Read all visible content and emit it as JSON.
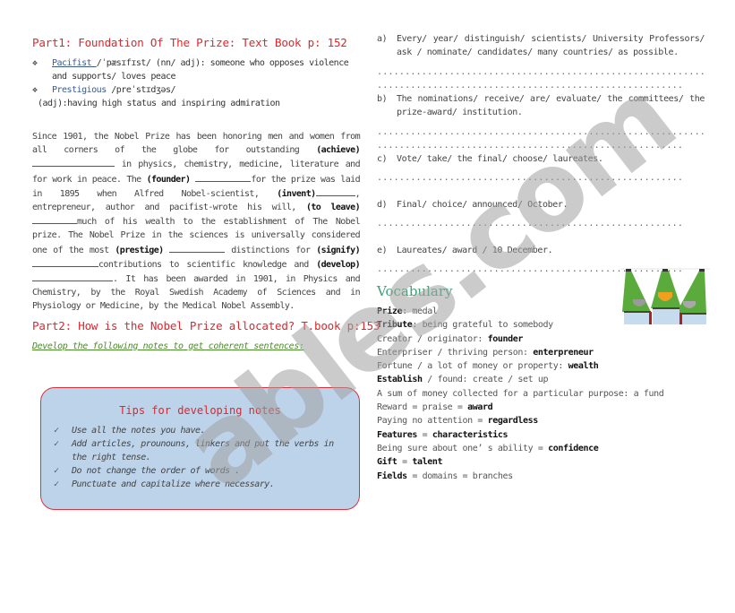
{
  "part1": {
    "title": "Part1: Foundation Of The Prize: Text Book p: 152",
    "definitions": [
      {
        "term": "Pacifist ",
        "phonetic": "/ˈpæsɪfɪst/ (nn/ adj): someone who opposes violence",
        "continuation": "and supports/ loves peace"
      },
      {
        "term": "Prestigious",
        "phonetic": " /preˈstɪdʒəs/",
        "continuation": "(adj):having high status and inspiring admiration"
      }
    ],
    "paragraph": {
      "t1": "Since 1901, the Nobel Prize has been honoring men and women from all corners of the globe for outstanding ",
      "w1": "(achieve)",
      "t2": " in physics, chemistry, medicine, literature and for work in peace. The ",
      "w2": "(founder)",
      "t3": "for the prize was laid in 1895 when Alfred Nobel-scientist, ",
      "w3": "(invent)",
      "t4": ", entrepreneur, author and pacifist-wrote his will, ",
      "w4": "(to leave)",
      "t5": "much of his wealth to the establishment of The Nobel prize. The Nobel Prize in the sciences is universally considered one of the most ",
      "w5": "(prestige)",
      "t6": " distinctions for ",
      "w6": "(signify)",
      "t7": "contributions to scientific knowledge and ",
      "w7": "(develop)",
      "t8": ". It has been awarded in 1901, in Physics and Chemistry, by the Royal Swedish Academy of Sciences and in Physiology or Medicine, by the Medical Nobel Assembly."
    }
  },
  "part2": {
    "title": "Part2: How is the Nobel Prize allocated? T.book p:153",
    "instruction": "Develop the following notes to get  coherent sentences:"
  },
  "tips": {
    "title": "Tips for developing notes",
    "items": [
      "Use all the notes you have.",
      "Add articles, prounouns, linkers and put the verbs in the right tense.",
      "Do not change the order of words .",
      "Punctuate and capitalize where necessary."
    ],
    "check_icon": "✓"
  },
  "notes": [
    {
      "letter": "a)",
      "text": "Every/ year/ distinguish/  scientists/ University Professors/ ask / nominate/  candidates/ many countries/ as possible."
    },
    {
      "letter": "b)",
      "text": "The nominations/ receive/ are/ evaluate/ the committees/ the prize-award/ institution."
    },
    {
      "letter": "c)",
      "text": "Vote/  take/  the final/  choose/  laureates."
    },
    {
      "letter": "d)",
      "text": "Final/ choice/ announced/ October."
    },
    {
      "letter": "e)",
      "text": " Laureates/ award / 10 December."
    }
  ],
  "dotline": "...........................................................",
  "dotline_short": ".......................................................",
  "vocabulary": {
    "title": "Vocabulary",
    "items": [
      {
        "b1": "Prize",
        "t1": ": medal",
        "b2": ""
      },
      {
        "b1": "Tribute",
        "t1": ": being grateful to somebody",
        "b2": ""
      },
      {
        "b1": "",
        "t1": "Creator / originator: ",
        "b2": "founder"
      },
      {
        "b1": "",
        "t1": "Enterpriser / thriving person: ",
        "b2": "enterpreneur"
      },
      {
        "b1": "",
        "t1": "Fortune / a lot of money or property: ",
        "b2": "wealth"
      },
      {
        "b1": "Establish",
        "t1": " / found: create / set up",
        "b2": ""
      },
      {
        "b1": "",
        "t1": "A sum of money collected for a particular purpose: a fund",
        "b2": ""
      },
      {
        "b1": "",
        "t1": "Reward = praise = ",
        "b2": "award"
      },
      {
        "b1": "",
        "t1": "Paying no attention = ",
        "b2": "regardless"
      },
      {
        "b1": "Features",
        "t1": " = ",
        "b2": "characteristics"
      },
      {
        "b1": "",
        "t1": "Being sure about one’ s ability = ",
        "b2": "confidence"
      },
      {
        "b1": "Gift",
        "t1": " = ",
        "b2": "talent"
      },
      {
        "b1": "Fields",
        "t1": " = domains = branches",
        "b2": ""
      }
    ]
  },
  "bullet_icon": "❖",
  "watermark": "ables.com"
}
